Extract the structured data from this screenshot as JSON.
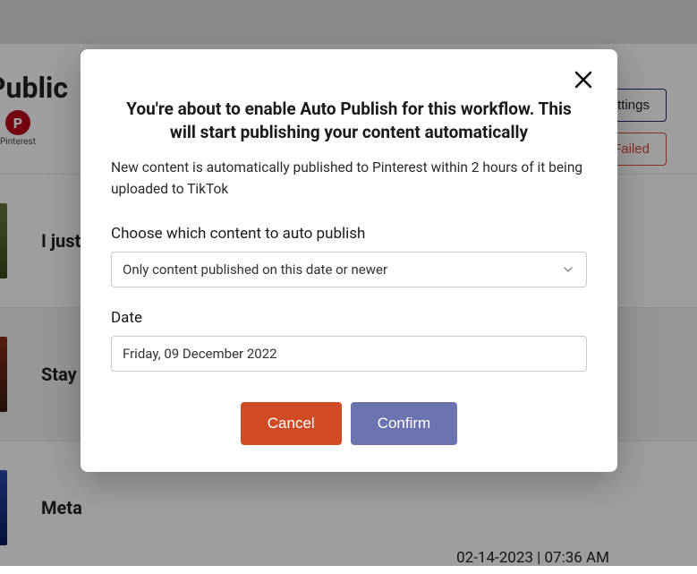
{
  "background": {
    "page_title": "n Public",
    "platform_label": "Pinterest",
    "platform_glyph": "P",
    "buttons": {
      "settings": "ettings",
      "retry_failed": "etry Failed"
    },
    "rows": [
      {
        "title": "I just"
      },
      {
        "title": "Stay"
      },
      {
        "title": "Meta",
        "timestamp": "02-14-2023 | 07:36 AM"
      }
    ]
  },
  "modal": {
    "title": "You're about to enable Auto Publish for this workflow. This will start publishing your content automatically",
    "description": "New content is automatically published to Pinterest within 2 hours of it being uploaded to TikTok",
    "select_label": "Choose which content to auto publish",
    "select_value": "Only content published on this date or newer",
    "date_label": "Date",
    "date_value": "Friday, 09 December 2022",
    "cancel": "Cancel",
    "confirm": "Confirm"
  }
}
